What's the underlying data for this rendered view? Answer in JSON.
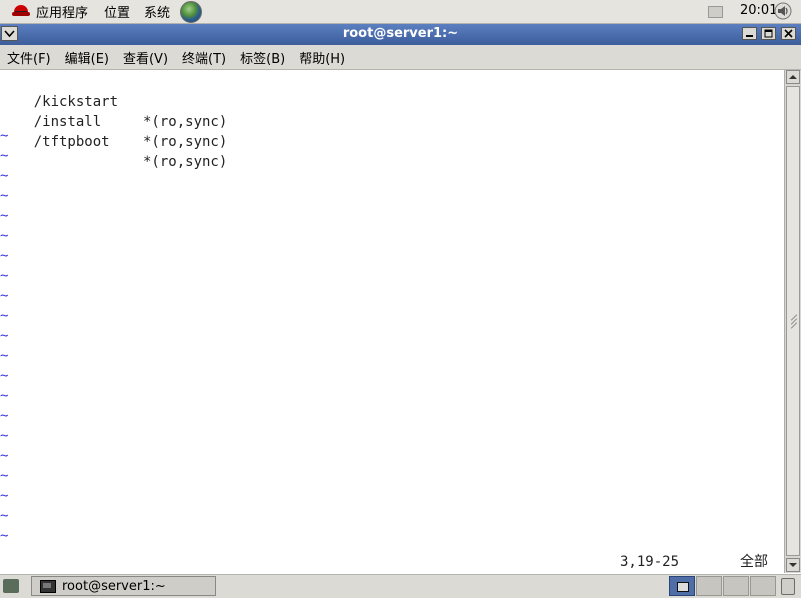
{
  "top_panel": {
    "menus": [
      "应用程序",
      "位置",
      "系统"
    ],
    "clock": "20:01"
  },
  "window": {
    "title": "root@server1:~",
    "menubar": [
      "文件(F)",
      "编辑(E)",
      "查看(V)",
      "终端(T)",
      "标签(B)",
      "帮助(H)"
    ]
  },
  "terminal": {
    "lines": [
      {
        "path": "/kickstart",
        "options": "*(ro,sync)"
      },
      {
        "path": "/install",
        "options": "*(ro,sync)"
      },
      {
        "path": "/tftpboot",
        "options": "*(ro,sync)"
      }
    ],
    "tilde": "~",
    "status_position": "3,19-25",
    "status_scope": "全部"
  },
  "taskbar": {
    "task_label": "root@server1:~"
  },
  "colors": {
    "titlebar": "#3d5d9c",
    "tilde": "#3838e0",
    "background": "#dcdad5"
  }
}
